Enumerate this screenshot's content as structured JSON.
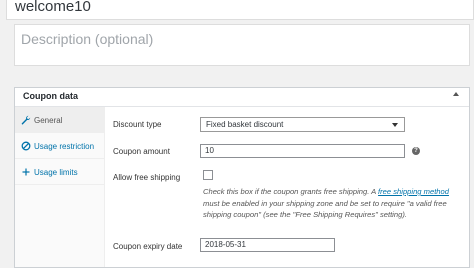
{
  "coupon": {
    "code": "welcome10",
    "description_placeholder": "Description (optional)"
  },
  "metabox": {
    "title": "Coupon data",
    "tabs": [
      {
        "label": "General",
        "icon": "wrench-icon"
      },
      {
        "label": "Usage restriction",
        "icon": "block-icon"
      },
      {
        "label": "Usage limits",
        "icon": "plus-icon"
      }
    ]
  },
  "general": {
    "discount_type_label": "Discount type",
    "discount_type_value": "Fixed basket discount",
    "amount_label": "Coupon amount",
    "amount_value": "10",
    "free_shipping_label": "Allow free shipping",
    "free_shipping_desc_1": "Check this box if the coupon grants free shipping. A ",
    "free_shipping_link": "free shipping method",
    "free_shipping_desc_2": " must be enabled in your shipping zone and be set to require \"a valid free shipping coupon\" (see the \"Free Shipping Requires\" setting).",
    "expiry_label": "Coupon expiry date",
    "expiry_value": "2018-05-31"
  },
  "colors": {
    "link": "#0073aa",
    "active_tab_bg": "#eeeeee"
  }
}
